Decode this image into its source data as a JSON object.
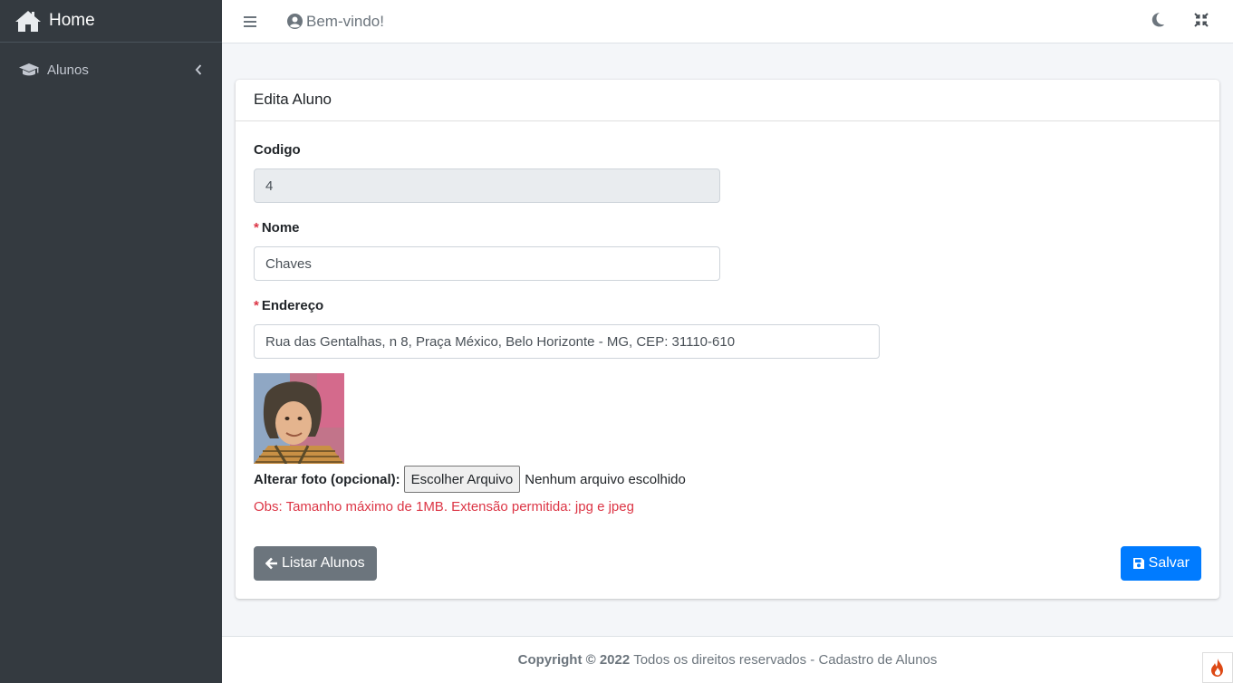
{
  "sidebar": {
    "brand_label": "Home",
    "brand_icon": "home-icon",
    "items": [
      {
        "label": "Alunos",
        "icon": "graduation-cap-icon"
      }
    ]
  },
  "topbar": {
    "welcome_text": "Bem-vindo!",
    "icons": [
      "menu-icon",
      "user-circle-icon",
      "moon-icon",
      "compress-icon"
    ]
  },
  "card": {
    "title": "Edita Aluno",
    "fields": {
      "codigo": {
        "label": "Codigo",
        "value": "4"
      },
      "nome": {
        "required_mark": "*",
        "label": "Nome",
        "value": "Chaves"
      },
      "endereco": {
        "required_mark": "*",
        "label": "Endereço",
        "value": "Rua das Gentalhas, n 8, Praça México, Belo Horizonte - MG, CEP: 31110-610"
      }
    },
    "photo": {
      "label": "Alterar foto (opcional):",
      "button_label": "Escolher Arquivo",
      "status": "Nenhum arquivo escolhido"
    },
    "obs": "Obs: Tamanho máximo de 1MB. Extensão permitida: jpg e jpeg",
    "buttons": {
      "list_label": "Listar Alunos",
      "save_label": "Salvar"
    }
  },
  "footer": {
    "copyright": "Copyright © 2022",
    "text": "Todos os direitos reservados - Cadastro de Alunos"
  },
  "colors": {
    "sidebar_bg": "#343a40",
    "primary": "#007bff",
    "secondary": "#6c757d",
    "danger": "#dc3545"
  }
}
